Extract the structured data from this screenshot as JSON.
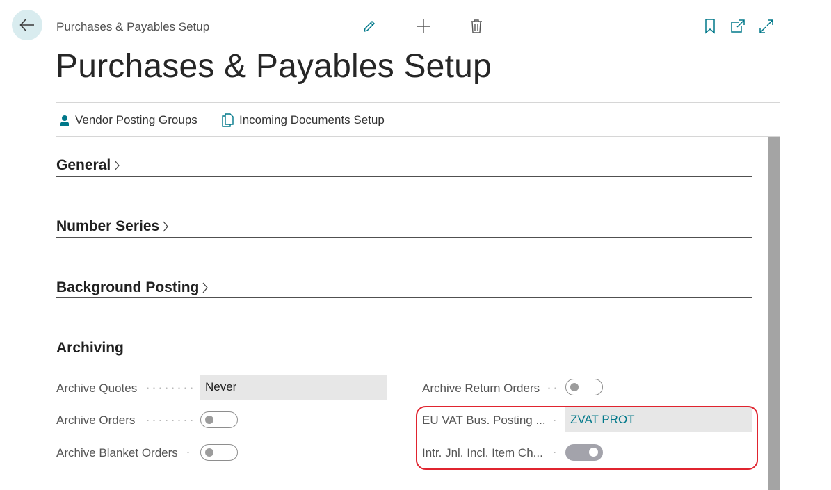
{
  "header": {
    "breadcrumb": "Purchases & Payables Setup",
    "title": "Purchases & Payables Setup"
  },
  "toolbar": {
    "icons": [
      "pencil-icon",
      "plus-icon",
      "trash-icon",
      "bookmark-icon",
      "open-new-window-icon",
      "expand-icon"
    ]
  },
  "actions": {
    "vendor_posting_groups": "Vendor Posting Groups",
    "incoming_documents_setup": "Incoming Documents Setup"
  },
  "sections": {
    "general": "General",
    "number_series": "Number Series",
    "background_posting": "Background Posting",
    "archiving": "Archiving"
  },
  "archiving": {
    "archive_quotes_label": "Archive Quotes",
    "archive_quotes_value": "Never",
    "archive_orders_label": "Archive Orders",
    "archive_orders_on": false,
    "archive_blanket_orders_label": "Archive Blanket Orders",
    "archive_blanket_orders_on": false,
    "archive_return_orders_label": "Archive Return Orders",
    "archive_return_orders_on": false,
    "eu_vat_label": "EU VAT Bus. Posting ...",
    "eu_vat_value": "ZVAT PROT",
    "intr_jnl_label": "Intr. Jnl. Incl. Item Ch...",
    "intr_jnl_on": true
  },
  "colors": {
    "accent": "#00788a",
    "highlight": "#e0242f",
    "back_button_bg": "#d9ecef"
  }
}
